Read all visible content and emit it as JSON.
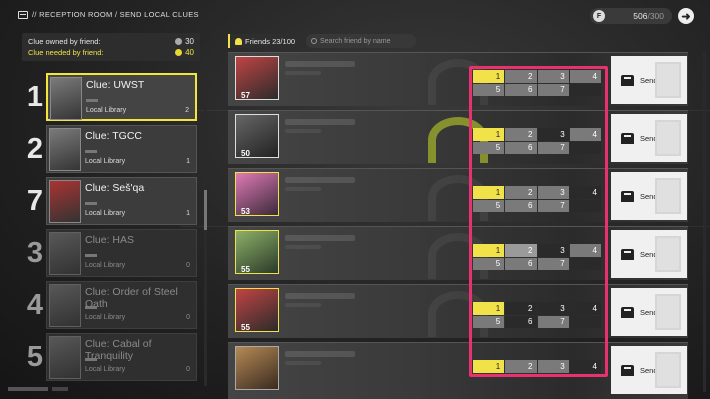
{
  "header": {
    "breadcrumb": "// RECEPTION ROOM  /  SEND LOCAL CLUES",
    "resource_value": "506",
    "resource_max": "/300",
    "resource_icon": "F"
  },
  "summary": {
    "owned_label": "Clue owned by friend:",
    "owned_value": "30",
    "needed_label": "Clue needed by friend:",
    "needed_value": "40"
  },
  "clues": [
    {
      "num": "1",
      "name": "Clue: UWST",
      "source": "Local Library",
      "count": "2"
    },
    {
      "num": "2",
      "name": "Clue: TGCC",
      "source": "Local Library",
      "count": "1"
    },
    {
      "num": "7",
      "name": "Clue: Seš'qa",
      "source": "Local Library",
      "count": "1"
    },
    {
      "num": "3",
      "name": "Clue: HAS",
      "source": "Local Library",
      "count": "0"
    },
    {
      "num": "4",
      "name": "Clue: Order of Steel Oath",
      "source": "Local Library",
      "count": "0"
    },
    {
      "num": "5",
      "name": "Clue: Cabal of Tranquility",
      "source": "Local Library",
      "count": "0"
    }
  ],
  "friends_header": {
    "count_label": "Friends 23/100",
    "search_placeholder": "Search friend by name"
  },
  "friends": [
    {
      "level": "57",
      "cells": [
        "1",
        "2",
        "3",
        "4",
        "5",
        "6",
        "7"
      ]
    },
    {
      "level": "50",
      "cells": [
        "1",
        "2",
        "3",
        "4",
        "5",
        "6",
        "7"
      ]
    },
    {
      "level": "53",
      "cells": [
        "1",
        "2",
        "3",
        "4",
        "5",
        "6",
        "7"
      ]
    },
    {
      "level": "55",
      "cells": [
        "1",
        "2",
        "3",
        "4",
        "5",
        "6",
        "7"
      ]
    },
    {
      "level": "55",
      "cells": [
        "1",
        "2",
        "3",
        "4",
        "5",
        "6",
        "7"
      ]
    },
    {
      "level": "",
      "cells": [
        "1",
        "2",
        "3",
        "4"
      ]
    }
  ],
  "send_label": "Send",
  "colors": {
    "accent": "#f1e24a",
    "highlight": "#e8316f"
  }
}
